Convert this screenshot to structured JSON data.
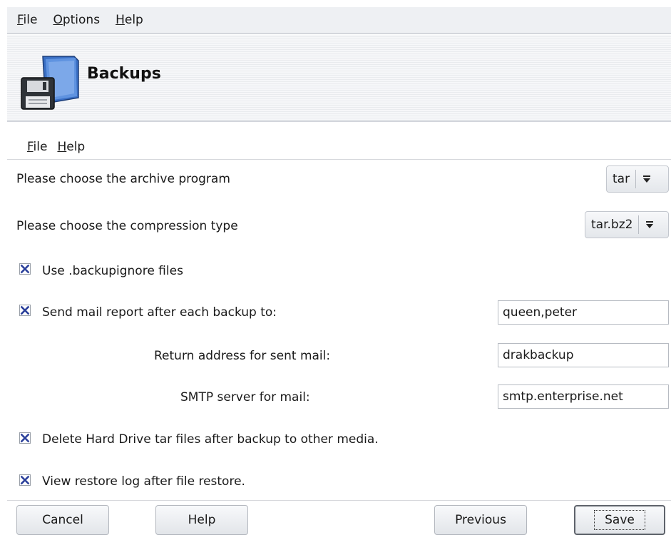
{
  "menubar": {
    "items": [
      "File",
      "Options",
      "Help"
    ]
  },
  "banner": {
    "title": "Backups",
    "icon": "floppy-folder-icon"
  },
  "submenu": {
    "items": [
      "File",
      "Help"
    ]
  },
  "archive": {
    "label": "Please choose the archive program",
    "value": "tar"
  },
  "compression": {
    "label": "Please choose the compression type",
    "value": "tar.bz2"
  },
  "options": {
    "use_backupignore": {
      "label": "Use .backupignore files",
      "checked": true
    },
    "send_mail": {
      "label": "Send mail report after each backup to:",
      "checked": true,
      "value": "queen,peter"
    },
    "return_address": {
      "label": "Return address for sent mail:",
      "value": "drakbackup"
    },
    "smtp_server": {
      "label": "SMTP server for mail:",
      "value": "smtp.enterprise.net"
    },
    "delete_tar": {
      "label": "Delete Hard Drive tar files after backup to other media.",
      "checked": true
    },
    "view_log": {
      "label": "View restore log after file restore.",
      "checked": true
    }
  },
  "buttons": {
    "cancel": "Cancel",
    "help": "Help",
    "previous": "Previous",
    "save": "Save"
  },
  "colors": {
    "check_mark": "#2a3f9a",
    "banner_bg": "#f0f1f4"
  }
}
